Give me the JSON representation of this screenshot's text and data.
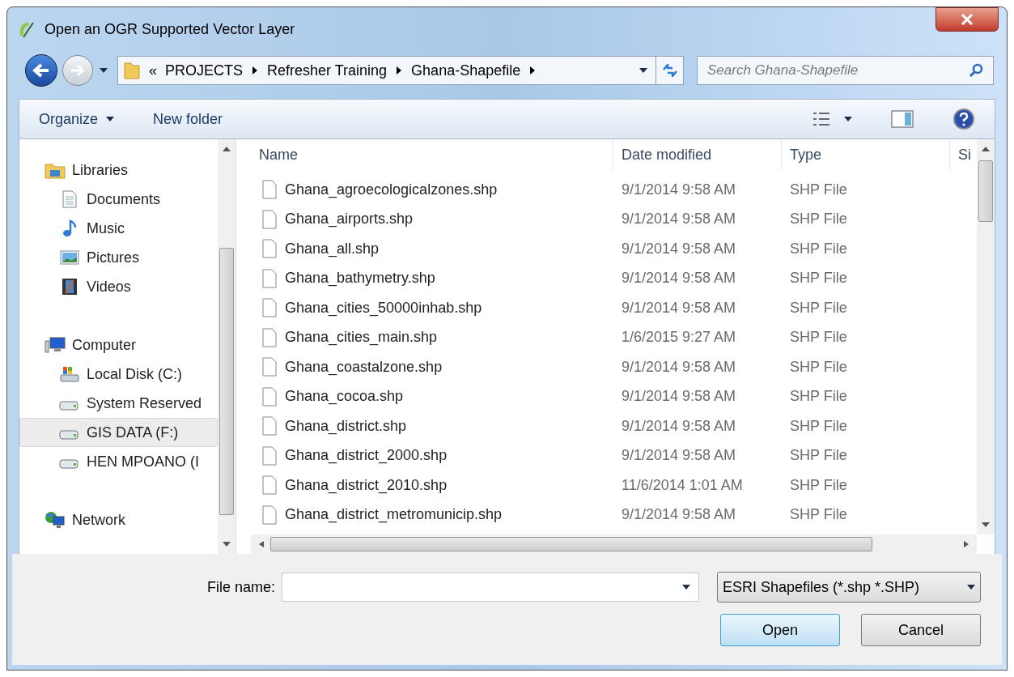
{
  "window": {
    "title": "Open an OGR Supported Vector Layer"
  },
  "address_bar": {
    "overflow": "«",
    "path": [
      "PROJECTS",
      "Refresher Training",
      "Ghana-Shapefile"
    ]
  },
  "search": {
    "placeholder": "Search Ghana-Shapefile"
  },
  "toolbar": {
    "items": [
      "Organize",
      "New folder"
    ]
  },
  "sidebar": {
    "groups": [
      {
        "label": "Libraries",
        "kind": "libraries",
        "selected": false,
        "children": [
          {
            "label": "Documents",
            "kind": "documents",
            "selected": false
          },
          {
            "label": "Music",
            "kind": "music",
            "selected": false
          },
          {
            "label": "Pictures",
            "kind": "pictures",
            "selected": false
          },
          {
            "label": "Videos",
            "kind": "videos",
            "selected": false
          }
        ]
      },
      {
        "label": "Computer",
        "kind": "computer",
        "selected": false,
        "children": [
          {
            "label": "Local Disk (C:)",
            "kind": "system-disk",
            "selected": false
          },
          {
            "label": "System Reserved",
            "kind": "disk",
            "selected": false
          },
          {
            "label": "GIS DATA (F:)",
            "kind": "disk",
            "selected": true
          },
          {
            "label": "HEN MPOANO (I",
            "kind": "disk",
            "selected": false
          }
        ]
      },
      {
        "label": "Network",
        "kind": "network",
        "selected": false
      }
    ]
  },
  "table": {
    "columns": [
      "Name",
      "Date modified",
      "Type",
      "Si"
    ],
    "rows": [
      [
        "Ghana_agroecologicalzones.shp",
        "9/1/2014 9:58 AM",
        "SHP File"
      ],
      [
        "Ghana_airports.shp",
        "9/1/2014 9:58 AM",
        "SHP File"
      ],
      [
        "Ghana_all.shp",
        "9/1/2014 9:58 AM",
        "SHP File"
      ],
      [
        "Ghana_bathymetry.shp",
        "9/1/2014 9:58 AM",
        "SHP File"
      ],
      [
        "Ghana_cities_50000inhab.shp",
        "9/1/2014 9:58 AM",
        "SHP File"
      ],
      [
        "Ghana_cities_main.shp",
        "1/6/2015 9:27 AM",
        "SHP File"
      ],
      [
        "Ghana_coastalzone.shp",
        "9/1/2014 9:58 AM",
        "SHP File"
      ],
      [
        "Ghana_cocoa.shp",
        "9/1/2014 9:58 AM",
        "SHP File"
      ],
      [
        "Ghana_district.shp",
        "9/1/2014 9:58 AM",
        "SHP File"
      ],
      [
        "Ghana_district_2000.shp",
        "9/1/2014 9:58 AM",
        "SHP File"
      ],
      [
        "Ghana_district_2010.shp",
        "11/6/2014 1:01 AM",
        "SHP File"
      ],
      [
        "Ghana_district_metromunicip.shp",
        "9/1/2014 9:58 AM",
        "SHP File"
      ]
    ]
  },
  "file_name": {
    "label": "File name:"
  },
  "file_type": {
    "value": "ESRI Shapefiles (*.shp *.SHP)"
  },
  "buttons": [
    {
      "label": "Open",
      "default": true
    },
    {
      "label": "Cancel",
      "default": false
    }
  ]
}
